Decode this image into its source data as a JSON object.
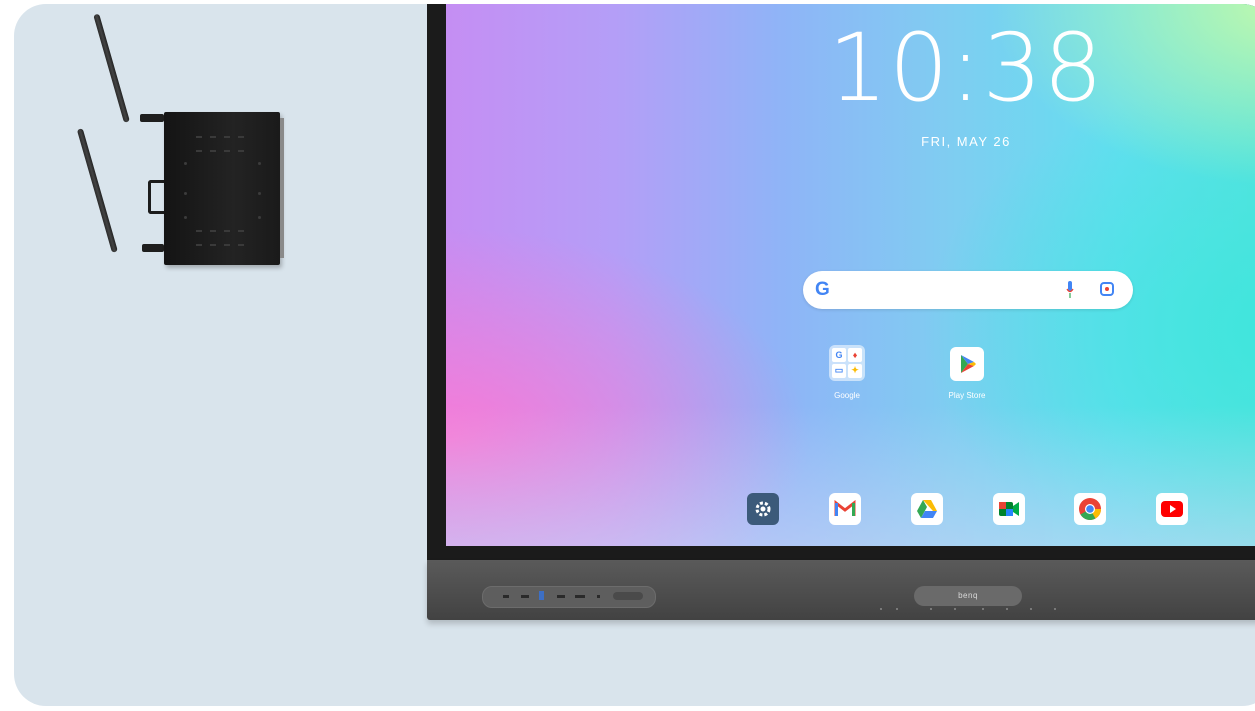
{
  "screen": {
    "time": "10:38",
    "date": "FRI, MAY 26"
  },
  "search": {
    "logo": "G",
    "icons": [
      "mic-icon",
      "lens-icon"
    ]
  },
  "apps": [
    {
      "label": "Google",
      "icon": "google-folder-icon"
    },
    {
      "label": "Play Store",
      "icon": "play-store-icon"
    }
  ],
  "dock": [
    {
      "icon": "settings-icon"
    },
    {
      "icon": "gmail-icon"
    },
    {
      "icon": "drive-icon"
    },
    {
      "icon": "meet-icon"
    },
    {
      "icon": "chrome-icon"
    },
    {
      "icon": "youtube-icon"
    }
  ],
  "soundbar": {
    "brand": "benq"
  },
  "colors": {
    "background_card": "#d9e4ec",
    "bezel": "#1b1b1b",
    "soundbar": "#4c4c4c"
  }
}
